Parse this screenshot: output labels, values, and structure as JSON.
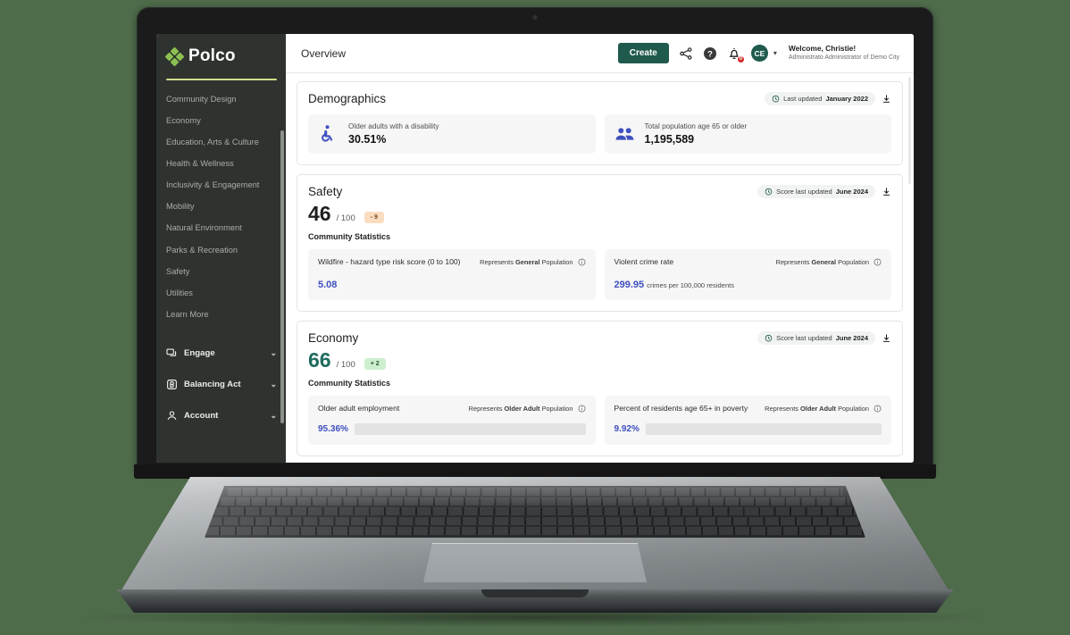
{
  "brand": {
    "name": "Polco",
    "logo_icon": "polco-diamond-logo",
    "accent": "#8cc152",
    "rule_color": "#cfe08a"
  },
  "sidebar": {
    "nav_items": [
      {
        "label": "Community Design"
      },
      {
        "label": "Economy"
      },
      {
        "label": "Education, Arts & Culture"
      },
      {
        "label": "Health & Wellness"
      },
      {
        "label": "Inclusivity & Engagement"
      },
      {
        "label": "Mobility"
      },
      {
        "label": "Natural Environment"
      },
      {
        "label": "Parks & Recreation"
      },
      {
        "label": "Safety"
      },
      {
        "label": "Utilities"
      },
      {
        "label": "Learn More"
      }
    ],
    "sections": [
      {
        "label": "Engage",
        "icon": "chat-bubbles-icon",
        "chevron": "⌄"
      },
      {
        "label": "Balancing Act",
        "icon": "balancing-act-b-icon",
        "chevron": "⌄"
      },
      {
        "label": "Account",
        "icon": "person-icon",
        "chevron": "⌄"
      }
    ]
  },
  "topbar": {
    "page_title": "Overview",
    "create_label": "Create",
    "share_icon": "share-icon",
    "help_icon": "question-circle-icon",
    "bell_icon": "bell-icon",
    "bell_count": "0",
    "avatar_initials": "CE",
    "caret": "▾",
    "welcome": "Welcome, Christie!",
    "role": "Administrato  Administrator of Demo City"
  },
  "cards": [
    {
      "title": "Demographics",
      "updated_label": "Last updated",
      "updated_value": "January 2022",
      "clock_icon": "clock-history-icon",
      "download_icon": "download-icon",
      "type": "demographics",
      "tiles": [
        {
          "icon": "wheelchair-accessible-icon",
          "label": "Older adults with a disability",
          "value": "30.51%"
        },
        {
          "icon": "people-group-icon",
          "label": "Total population age 65 or older",
          "value": "1,195,589"
        }
      ]
    },
    {
      "title": "Safety",
      "updated_label": "Score last updated",
      "updated_value": "June 2024",
      "clock_icon": "clock-history-icon",
      "download_icon": "download-icon",
      "type": "score",
      "score": "46",
      "score_denominator": "/ 100",
      "score_color": "#1f1f1f",
      "delta": "- 9",
      "delta_bg": "#fadcc0",
      "delta_color": "#7a4a18",
      "stats_heading": "Community Statistics",
      "metrics": [
        {
          "name": "Wildfire - hazard type risk score (0 to 100)",
          "represents_prefix": "Represents",
          "represents_bold": "General",
          "represents_suffix": "Population",
          "info_icon": "info-circle-icon",
          "display": "value",
          "value": "5.08",
          "unit": ""
        },
        {
          "name": "Violent crime rate",
          "represents_prefix": "Represents",
          "represents_bold": "General",
          "represents_suffix": "Population",
          "info_icon": "info-circle-icon",
          "display": "value",
          "value": "299.95",
          "unit": "crimes per 100,000 residents"
        }
      ]
    },
    {
      "title": "Economy",
      "updated_label": "Score last updated",
      "updated_value": "June 2024",
      "clock_icon": "clock-history-icon",
      "download_icon": "download-icon",
      "type": "score",
      "score": "66",
      "score_denominator": "/ 100",
      "score_color": "#1f6b5e",
      "delta": "+ 2",
      "delta_bg": "#cdefce",
      "delta_color": "#235c2c",
      "stats_heading": "Community Statistics",
      "metrics": [
        {
          "name": "Older adult employment",
          "represents_prefix": "Represents",
          "represents_bold": "Older Adult",
          "represents_suffix": "Population",
          "info_icon": "info-circle-icon",
          "display": "bar",
          "value": "95.36%",
          "percent": 95.36
        },
        {
          "name": "Percent of residents age 65+ in poverty",
          "represents_prefix": "Represents",
          "represents_bold": "Older Adult",
          "represents_suffix": "Population",
          "info_icon": "info-circle-icon",
          "display": "bar",
          "value": "9.92%",
          "percent": 9.92
        }
      ]
    }
  ]
}
